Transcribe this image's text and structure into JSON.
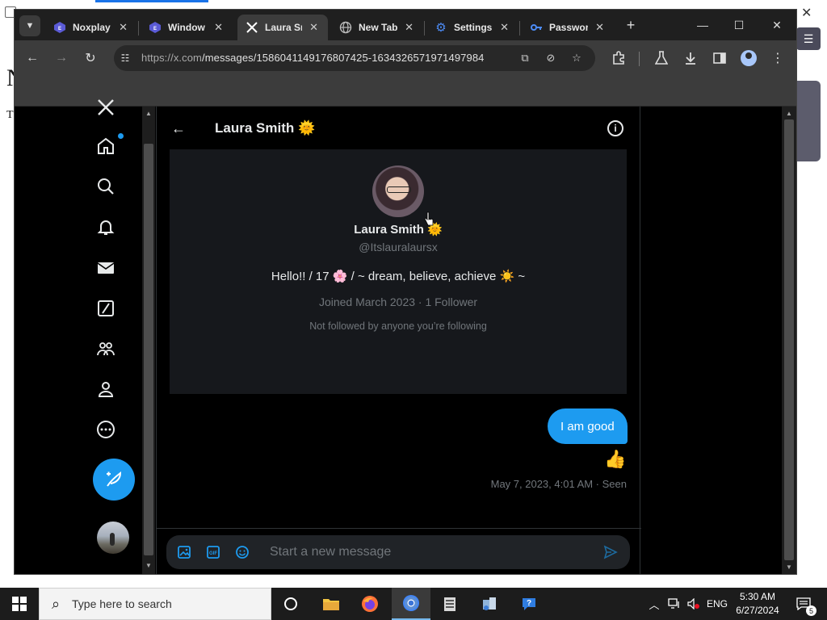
{
  "background": {
    "heading_letter": "N",
    "text_letter": "T"
  },
  "browser": {
    "tabs": [
      {
        "label": "Noxplay",
        "icon": "noxplayer-icon"
      },
      {
        "label": "Window",
        "icon": "windows-icon"
      },
      {
        "label": "Laura Sn",
        "icon": "x-logo-icon",
        "active": true
      },
      {
        "label": "New Tab",
        "icon": "globe-icon"
      },
      {
        "label": "Settings",
        "icon": "gear-icon"
      },
      {
        "label": "Passwor",
        "icon": "key-icon"
      }
    ],
    "url_host": "https://x.com",
    "url_path": "/messages/1586041149176807425-1634326571971497984"
  },
  "dm": {
    "header_title": "Laura Smith 🌞",
    "profile": {
      "name": "Laura Smith 🌞",
      "handle": "@Itslauralaursx",
      "bio": "Hello!! / 17 🌸 / ~ dream, believe, achieve ☀️ ~",
      "joined": "Joined March 2023 · 1 Follower",
      "followed_note": "Not followed by anyone you’re following"
    },
    "messages": [
      {
        "text": "I am good",
        "reaction": "👍",
        "meta": "May 7, 2023, 4:01 AM · Seen"
      }
    ],
    "composer": {
      "placeholder": "Start a new message"
    }
  },
  "taskbar": {
    "search_placeholder": "Type here to search",
    "language": "ENG",
    "time": "5:30 AM",
    "date": "6/27/2024",
    "notification_count": "5"
  },
  "colors": {
    "accent": "#1d9bf0",
    "page_bg": "#000000",
    "card_bg": "#16181c",
    "muted_text": "#71767b"
  }
}
